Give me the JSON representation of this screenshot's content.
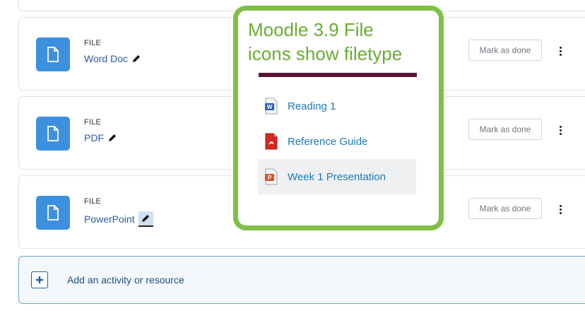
{
  "activities": [
    {
      "type": "FILE",
      "name": "Word Doc",
      "mark_label": "Mark as done"
    },
    {
      "type": "FILE",
      "name": "PDF",
      "mark_label": "Mark as done"
    },
    {
      "type": "FILE",
      "name": "PowerPoint",
      "mark_label": "Mark as done"
    }
  ],
  "add_activity": {
    "label": "Add an activity or resource"
  },
  "overlay": {
    "title_line1": "Moodle 3.9 File",
    "title_line2": "icons show filetype",
    "files": [
      {
        "name": "Reading 1",
        "icon": "word-file-icon"
      },
      {
        "name": "Reference Guide",
        "icon": "pdf-file-icon"
      },
      {
        "name": "Week 1 Presentation",
        "icon": "powerpoint-file-icon"
      }
    ]
  },
  "colors": {
    "file_tile": "#3d8fe0",
    "link": "#2a5d9f",
    "overlay_border": "#80c046",
    "overlay_title": "#6aad2f",
    "underline": "#5c1436"
  }
}
